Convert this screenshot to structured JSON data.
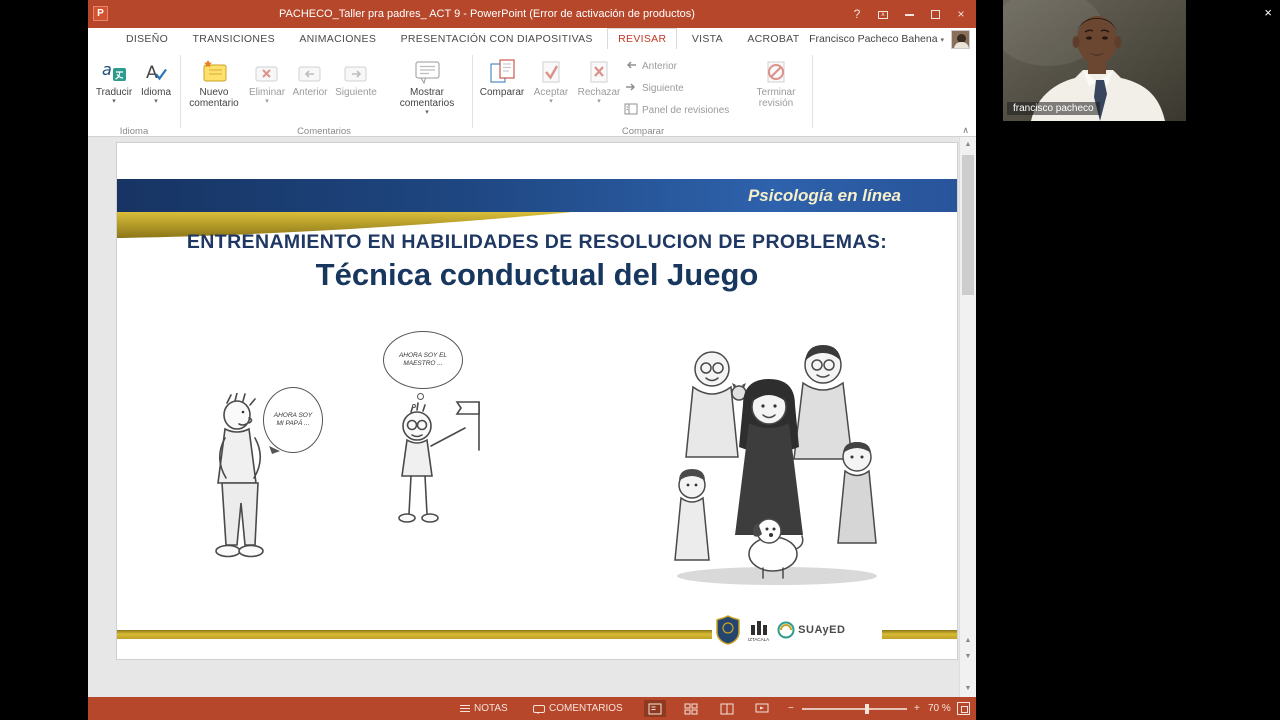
{
  "colors": {
    "ppt_red": "#B7472A",
    "gold": "#C19B25",
    "navy": "#1F3763",
    "band_blue": "#1E4680"
  },
  "window": {
    "title": "PACHECO_Taller pra padres_ ACT 9 -  PowerPoint (Error de activación de productos)"
  },
  "glyphs": {
    "help": "?",
    "close": "×",
    "dropdown": "▾",
    "collapse": "∧",
    "scroll_up": "▲",
    "scroll_down": "▼",
    "zoom_minus": "−",
    "zoom_plus": "+"
  },
  "ribbon": {
    "tabs": [
      {
        "label": "DISEÑO"
      },
      {
        "label": "TRANSICIONES"
      },
      {
        "label": "ANIMACIONES"
      },
      {
        "label": "PRESENTACIÓN CON DIAPOSITIVAS"
      },
      {
        "label": "REVISAR",
        "active": true
      },
      {
        "label": "VISTA"
      },
      {
        "label": "ACROBAT"
      }
    ],
    "account": "Francisco Pacheco Bahena",
    "traducir": "Traducir",
    "idioma_button": "Idioma",
    "group_idioma": "Idioma",
    "nuevo_comentario": "Nuevo comentario",
    "eliminar": "Eliminar",
    "anterior_comentario": "Anterior",
    "siguiente_comentario": "Siguiente",
    "mostrar_comentarios": "Mostrar comentarios",
    "group_comentarios": "Comentarios",
    "comparar_button": "Comparar",
    "aceptar": "Aceptar",
    "rechazar": "Rechazar",
    "anterior_revision": "Anterior",
    "siguiente_revision": "Siguiente",
    "panel_revisiones": "Panel de revisiones",
    "terminar_revision": "Terminar revisión",
    "group_comparar": "Comparar"
  },
  "slide": {
    "brand": "Psicología en línea",
    "title_line1": "ENTRENAMIENTO EN HABILIDADES DE RESOLUCION DE PROBLEMAS:",
    "title_line2": "Técnica conductual del Juego",
    "bubble_left": "AHORA SOY MI PAPÁ ...",
    "bubble_middle": "AHORA SOY EL MAESTRO ...",
    "logo_iztacala": "IZTACALA",
    "logo_suayed": "SUAyED"
  },
  "status": {
    "notas": "NOTAS",
    "comentarios": "COMENTARIOS",
    "zoom_level": "70 %"
  },
  "webcam": {
    "label": "francisco pacheco"
  }
}
